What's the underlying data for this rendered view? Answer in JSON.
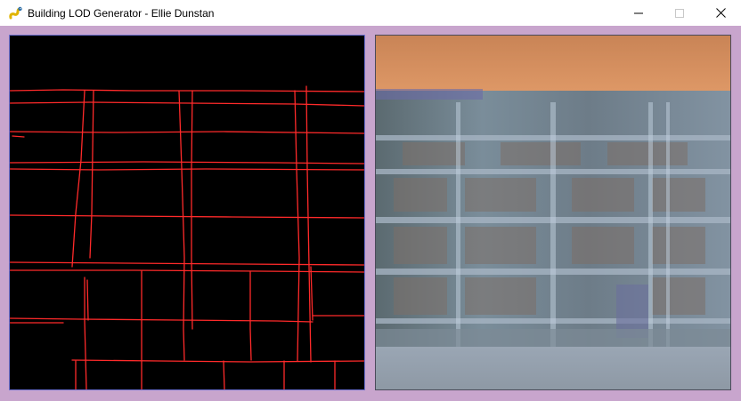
{
  "window": {
    "title": "Building LOD Generator - Ellie Dunstan",
    "app_icon": "pygame-snake-icon",
    "controls": [
      "minimize-icon",
      "maximize-icon",
      "close-icon"
    ]
  },
  "colors": {
    "background": "#c8a5cd",
    "edge_lines": "#ff2a2a",
    "edge_canvas": "#000000",
    "sky": "#d38f5e"
  },
  "panels": {
    "left": {
      "content": "edge-map-input",
      "label": ""
    },
    "right": {
      "content": "generated-building-facade",
      "label": ""
    }
  }
}
